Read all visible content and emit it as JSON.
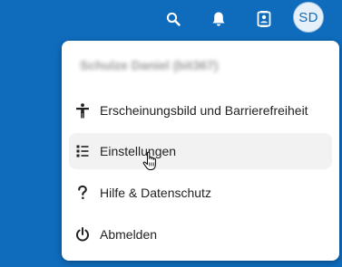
{
  "topbar": {
    "icons": [
      "search-icon",
      "bell-icon",
      "contacts-icon"
    ],
    "avatar_initials": "SD",
    "background_color": "#0f6cbd"
  },
  "menu": {
    "user_name": "Schulze Daniel (bit367)",
    "items": [
      {
        "label": "Erscheinungsbild und Barrierefreiheit",
        "icon": "accessibility-icon"
      },
      {
        "label": "Einstellungen",
        "icon": "settings-list-icon",
        "hovered": true
      },
      {
        "label": "Hilfe & Datenschutz",
        "icon": "question-mark-icon"
      },
      {
        "label": "Abmelden",
        "icon": "power-icon"
      }
    ]
  }
}
